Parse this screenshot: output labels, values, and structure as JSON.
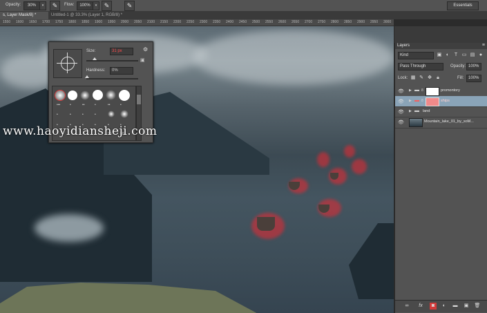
{
  "options_bar": {
    "opacity_label": "Opacity:",
    "opacity_value": "30%",
    "flow_label": "Flow:",
    "flow_value": "100%",
    "workspace": "Essentials",
    "icons": [
      "pressure-opacity-icon",
      "airbrush-icon",
      "pressure-size-icon"
    ]
  },
  "tabs": [
    {
      "label": "s, Layer Mask/8) *"
    },
    {
      "label": "Untitled-1 @ 33.3% (Layer 1, RGB/8) *"
    }
  ],
  "ruler": {
    "ticks": [
      "1550",
      "1600",
      "1650",
      "1700",
      "1750",
      "1800",
      "1850",
      "1900",
      "1950",
      "2000",
      "2050",
      "2100",
      "2150",
      "2200",
      "2250",
      "2300",
      "2350",
      "2400",
      "2450",
      "2500",
      "2550",
      "2600",
      "2650",
      "2700",
      "2750",
      "2800",
      "2850",
      "2900",
      "2950",
      "3000"
    ]
  },
  "brush_popup": {
    "size_label": "Size:",
    "size_value": "31 px",
    "hardness_label": "Hardness:",
    "hardness_value": "0%",
    "presets": [
      {
        "number": ""
      },
      {
        "number": ""
      },
      {
        "number": ""
      },
      {
        "number": ""
      },
      {
        "number": ""
      },
      {
        "number": ""
      },
      {
        "number": "25"
      },
      {
        "number": "50"
      }
    ]
  },
  "watermark": "www.haoyidiansheji.com",
  "layers_panel": {
    "title": "Layers",
    "kind_filter": "Kind",
    "blend_mode": "Pass Through",
    "opacity_label": "Opacity:",
    "opacity_value": "100%",
    "lock_label": "Lock:",
    "fill_label": "Fill:",
    "fill_value": "100%",
    "layers": [
      {
        "name": "promontory",
        "selected": false
      },
      {
        "name": "ships",
        "selected": true
      },
      {
        "name": "land",
        "selected": false
      },
      {
        "name": "Mountain_lake_01_by_soM...",
        "selected": false
      }
    ]
  },
  "colors": {
    "selected_layer": "#8aa4b8",
    "mask_brush_red": "#e82832",
    "panel_bg": "#535353"
  }
}
